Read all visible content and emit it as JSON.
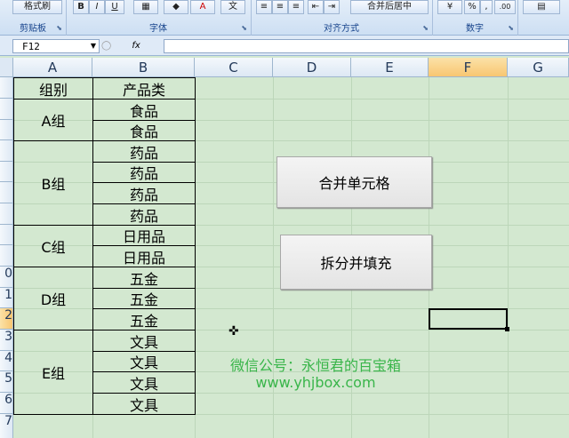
{
  "ribbon": {
    "groups": [
      {
        "label": "剪贴板",
        "button": "格式刷"
      },
      {
        "label": "字体",
        "buttons": [
          "B",
          "I",
          "U",
          "A"
        ]
      },
      {
        "label": "对齐方式",
        "button": "合并后居中"
      },
      {
        "label": "数字",
        "buttons": [
          "%",
          ",",
          ".00"
        ]
      }
    ]
  },
  "formula_bar": {
    "name_box": "F12",
    "fx": "fx",
    "formula": ""
  },
  "columns": [
    "A",
    "B",
    "C",
    "D",
    "E",
    "F",
    "G"
  ],
  "rows": [
    "",
    "",
    "",
    "",
    "",
    "",
    "",
    "",
    "",
    "0",
    "1",
    "2",
    "3",
    "4",
    "5",
    "6",
    "7"
  ],
  "selected_column": "F",
  "selected_row": "2",
  "table": {
    "header": {
      "group": "组别",
      "category": "产品类"
    },
    "groups": [
      "A组",
      "B组",
      "C组",
      "D组",
      "E组"
    ],
    "items": [
      "食品",
      "食品",
      "药品",
      "药品",
      "药品",
      "药品",
      "日用品",
      "日用品",
      "五金",
      "五金",
      "五金",
      "文具",
      "文具",
      "文具",
      "文具"
    ]
  },
  "buttons": {
    "merge": "合并单元格",
    "split": "拆分并填充"
  },
  "watermark": {
    "line1": "微信公号：永恒君的百宝箱",
    "line2": "www.yhjbox.com"
  },
  "cursor_icon": "move-cross-icon"
}
